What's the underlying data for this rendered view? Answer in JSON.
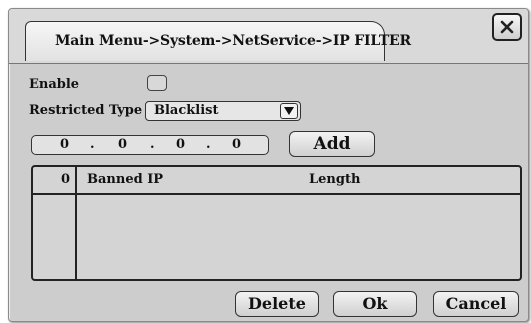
{
  "dialog": {
    "title": "Main Menu->System->NetService->IP FILTER",
    "close_icon": "close-icon"
  },
  "form": {
    "enable_label": "Enable",
    "enable_checked": false,
    "restricted_type_label": "Restricted Type",
    "restricted_type_value": "Blacklist",
    "ip_segments": [
      "0",
      "0",
      "0",
      "0"
    ],
    "add_label": "Add"
  },
  "table": {
    "count": "0",
    "col_banned_ip": "Banned IP",
    "col_length": "Length",
    "rows": []
  },
  "footer": {
    "delete_label": "Delete",
    "ok_label": "Ok",
    "cancel_label": "Cancel"
  }
}
